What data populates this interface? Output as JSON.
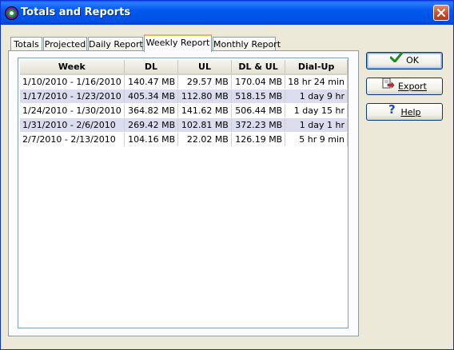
{
  "window": {
    "title": "Totals and Reports"
  },
  "tabs": [
    {
      "label": "Totals"
    },
    {
      "label": "Projected"
    },
    {
      "label": "Daily Report"
    },
    {
      "label": "Weekly Report",
      "active": true
    },
    {
      "label": "Monthly Report"
    }
  ],
  "table": {
    "headers": [
      "Week",
      "DL",
      "UL",
      "DL & UL",
      "Dial-Up"
    ],
    "rows": [
      [
        "1/10/2010 - 1/16/2010",
        "140.47 MB",
        "29.57 MB",
        "170.04 MB",
        "18 hr 24 min"
      ],
      [
        "1/17/2010 - 1/23/2010",
        "405.34 MB",
        "112.80 MB",
        "518.15 MB",
        "1 day 9 hr"
      ],
      [
        "1/24/2010 - 1/30/2010",
        "364.82 MB",
        "141.62 MB",
        "506.44 MB",
        "1 day 15 hr"
      ],
      [
        "1/31/2010 - 2/6/2010",
        "269.42 MB",
        "102.81 MB",
        "372.23 MB",
        "1 day 1 hr"
      ],
      [
        "2/7/2010 - 2/13/2010",
        "104.16 MB",
        "22.02 MB",
        "126.19 MB",
        "5 hr 9 min"
      ]
    ]
  },
  "buttons": {
    "ok": {
      "label": "OK",
      "icon": "checkmark-icon"
    },
    "export": {
      "label": "Export",
      "icon": "export-icon"
    },
    "help": {
      "label": "Help",
      "icon": "question-mark-icon"
    }
  },
  "colors": {
    "titlebar": "#0058ee",
    "active_tab_accent": "#f7b63a",
    "alt_row": "#dcdcef"
  }
}
